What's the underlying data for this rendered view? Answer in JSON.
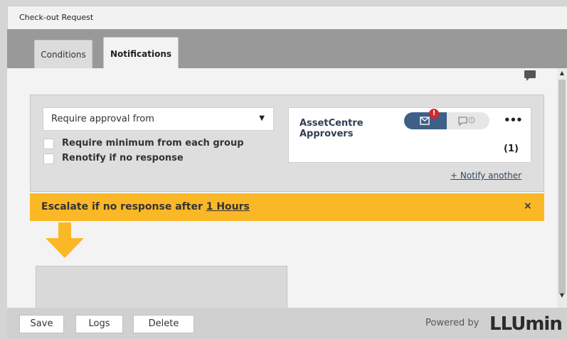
{
  "window": {
    "title": "Check-out Request"
  },
  "tabs": [
    {
      "label": "Conditions",
      "active": false
    },
    {
      "label": "Notifications",
      "active": true
    }
  ],
  "approval": {
    "select_value": "Require approval from",
    "checkboxes": [
      {
        "label": "Require minimum from each group",
        "checked": false
      },
      {
        "label": "Renotify if no response",
        "checked": false
      }
    ]
  },
  "group": {
    "name_line1": "AssetCentre",
    "name_line2": "Approvers",
    "email_badge": "!",
    "more_label": "•••",
    "count": "(1)"
  },
  "notify_another": "+ Notify another",
  "escalation": {
    "prefix": "Escalate if no response after ",
    "duration": "1 Hours",
    "close_label": "×",
    "color": "#fbb826"
  },
  "footer": {
    "buttons": [
      "Save",
      "Logs",
      "Delete"
    ],
    "powered_by": "Powered by",
    "logo": "LLUmin"
  },
  "colors": {
    "accent": "#3f5f86",
    "warning": "#fbb826",
    "badge": "#d7262a"
  },
  "icons": {
    "comment": "comment-icon",
    "email": "envelope-icon",
    "chat": "chat-bubble-icon",
    "arrow": "arrow-down-icon"
  }
}
